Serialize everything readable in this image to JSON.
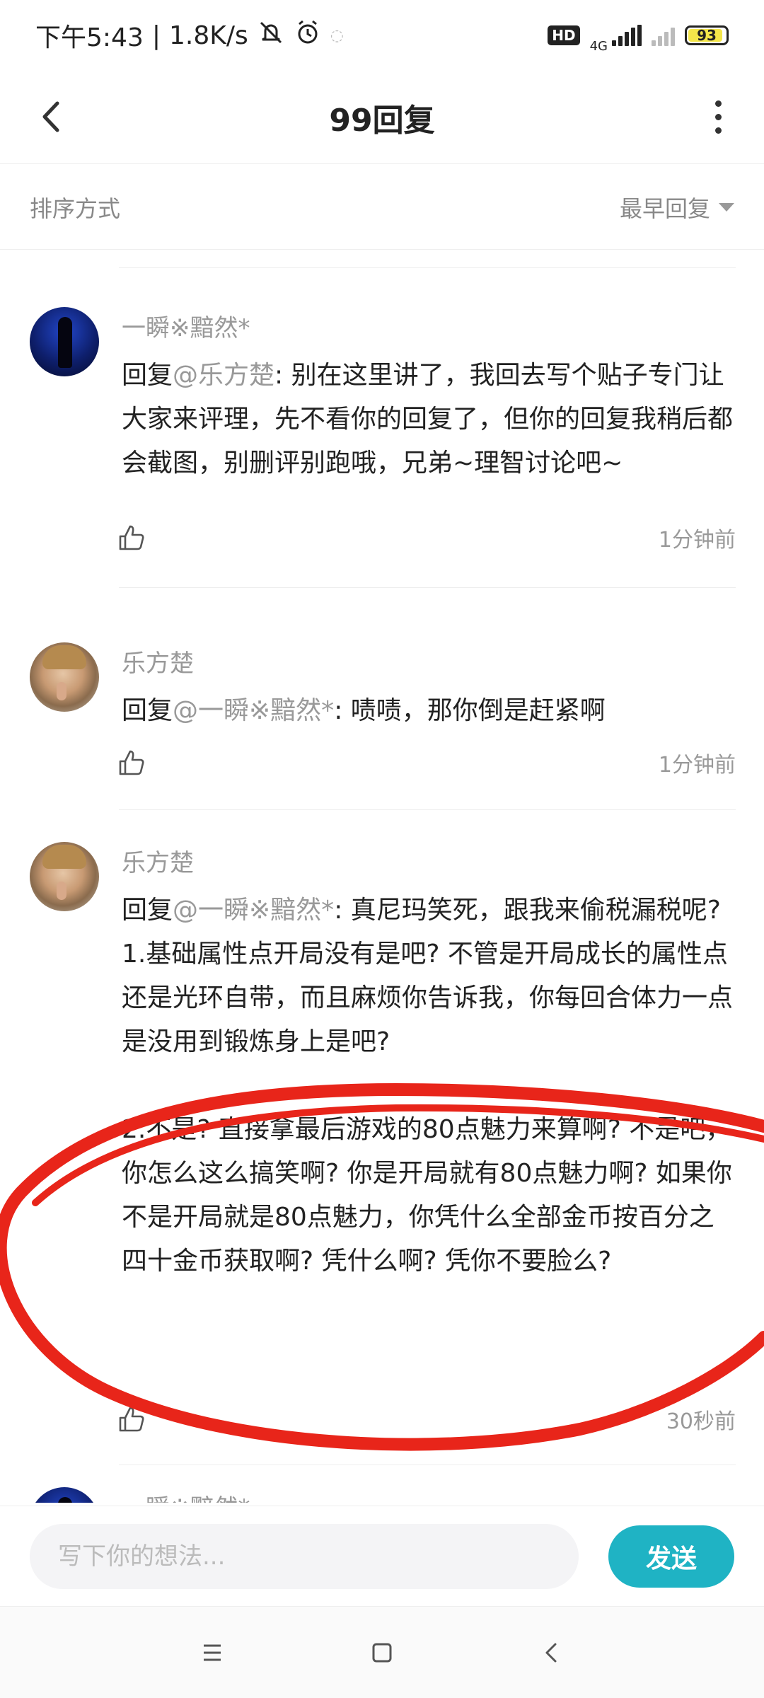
{
  "status_bar": {
    "time": "下午5:43",
    "separator": "|",
    "speed": "1.8K/s",
    "network_type": "4G",
    "hd": "HD",
    "battery": "93",
    "battery_level": 0.93
  },
  "header": {
    "title": "99回复",
    "back_icon": "chevron-left-icon",
    "more_icon": "more-vertical-icon"
  },
  "sort": {
    "label": "排序方式",
    "value": "最早回复"
  },
  "comments": [
    {
      "author": "一瞬※黯然*",
      "reply_prefix": "回复",
      "mention": "@乐方楚",
      "text": ": 别在这里讲了，我回去写个贴子专门让大家来评理，先不看你的回复了，但你的回复我稍后都会截图，别删评别跑哦，兄弟~理智讨论吧~",
      "time": "1分钟前"
    },
    {
      "author": "乐方楚",
      "reply_prefix": "回复",
      "mention": "@一瞬※黯然*",
      "text": ": 啧啧，那你倒是赶紧啊",
      "time": "1分钟前"
    },
    {
      "author": "乐方楚",
      "reply_prefix": "回复",
      "mention": "@一瞬※黯然*",
      "text": ": 真尼玛笑死，跟我来偷税漏税呢?\n1.基础属性点开局没有是吧? 不管是开局成长的属性点还是光环自带，而且麻烦你告诉我，你每回合体力一点是没用到锻炼身上是吧?\n\n2.不是? 直接拿最后游戏的80点魅力来算啊? 不是吧，你怎么这么搞笑啊? 你是开局就有80点魅力啊? 如果你不是开局就是80点魅力，你凭什么全部金币按百分之四十金币获取啊? 凭什么啊? 凭你不要脸么?",
      "time": "30秒前"
    },
    {
      "author": "一瞬※黯然*"
    }
  ],
  "input": {
    "placeholder": "写下你的想法...",
    "send_label": "发送"
  },
  "colors": {
    "accent": "#1fb3c4",
    "annotation": "#e8251a"
  },
  "nav": {
    "menu_icon": "menu-icon",
    "home_icon": "square-home-icon",
    "back_icon": "back-triangle-icon"
  }
}
